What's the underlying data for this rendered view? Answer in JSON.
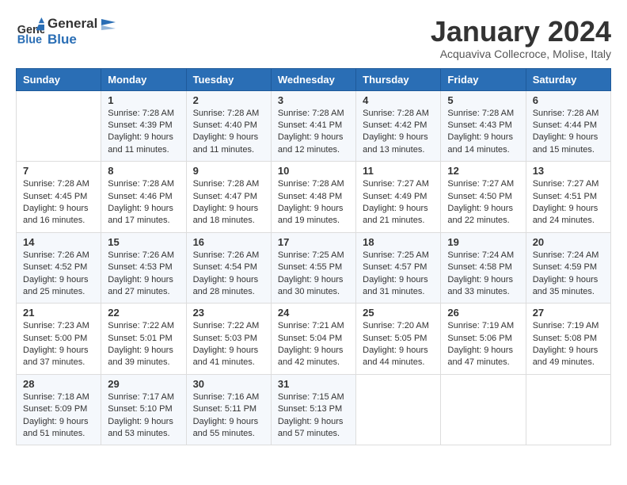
{
  "header": {
    "logo_line1": "General",
    "logo_line2": "Blue",
    "month": "January 2024",
    "location": "Acquaviva Collecroce, Molise, Italy"
  },
  "columns": [
    "Sunday",
    "Monday",
    "Tuesday",
    "Wednesday",
    "Thursday",
    "Friday",
    "Saturday"
  ],
  "weeks": [
    [
      {
        "day": "",
        "sunrise": "",
        "sunset": "",
        "daylight": ""
      },
      {
        "day": "1",
        "sunrise": "Sunrise: 7:28 AM",
        "sunset": "Sunset: 4:39 PM",
        "daylight": "Daylight: 9 hours and 11 minutes."
      },
      {
        "day": "2",
        "sunrise": "Sunrise: 7:28 AM",
        "sunset": "Sunset: 4:40 PM",
        "daylight": "Daylight: 9 hours and 11 minutes."
      },
      {
        "day": "3",
        "sunrise": "Sunrise: 7:28 AM",
        "sunset": "Sunset: 4:41 PM",
        "daylight": "Daylight: 9 hours and 12 minutes."
      },
      {
        "day": "4",
        "sunrise": "Sunrise: 7:28 AM",
        "sunset": "Sunset: 4:42 PM",
        "daylight": "Daylight: 9 hours and 13 minutes."
      },
      {
        "day": "5",
        "sunrise": "Sunrise: 7:28 AM",
        "sunset": "Sunset: 4:43 PM",
        "daylight": "Daylight: 9 hours and 14 minutes."
      },
      {
        "day": "6",
        "sunrise": "Sunrise: 7:28 AM",
        "sunset": "Sunset: 4:44 PM",
        "daylight": "Daylight: 9 hours and 15 minutes."
      }
    ],
    [
      {
        "day": "7",
        "sunrise": "Sunrise: 7:28 AM",
        "sunset": "Sunset: 4:45 PM",
        "daylight": "Daylight: 9 hours and 16 minutes."
      },
      {
        "day": "8",
        "sunrise": "Sunrise: 7:28 AM",
        "sunset": "Sunset: 4:46 PM",
        "daylight": "Daylight: 9 hours and 17 minutes."
      },
      {
        "day": "9",
        "sunrise": "Sunrise: 7:28 AM",
        "sunset": "Sunset: 4:47 PM",
        "daylight": "Daylight: 9 hours and 18 minutes."
      },
      {
        "day": "10",
        "sunrise": "Sunrise: 7:28 AM",
        "sunset": "Sunset: 4:48 PM",
        "daylight": "Daylight: 9 hours and 19 minutes."
      },
      {
        "day": "11",
        "sunrise": "Sunrise: 7:27 AM",
        "sunset": "Sunset: 4:49 PM",
        "daylight": "Daylight: 9 hours and 21 minutes."
      },
      {
        "day": "12",
        "sunrise": "Sunrise: 7:27 AM",
        "sunset": "Sunset: 4:50 PM",
        "daylight": "Daylight: 9 hours and 22 minutes."
      },
      {
        "day": "13",
        "sunrise": "Sunrise: 7:27 AM",
        "sunset": "Sunset: 4:51 PM",
        "daylight": "Daylight: 9 hours and 24 minutes."
      }
    ],
    [
      {
        "day": "14",
        "sunrise": "Sunrise: 7:26 AM",
        "sunset": "Sunset: 4:52 PM",
        "daylight": "Daylight: 9 hours and 25 minutes."
      },
      {
        "day": "15",
        "sunrise": "Sunrise: 7:26 AM",
        "sunset": "Sunset: 4:53 PM",
        "daylight": "Daylight: 9 hours and 27 minutes."
      },
      {
        "day": "16",
        "sunrise": "Sunrise: 7:26 AM",
        "sunset": "Sunset: 4:54 PM",
        "daylight": "Daylight: 9 hours and 28 minutes."
      },
      {
        "day": "17",
        "sunrise": "Sunrise: 7:25 AM",
        "sunset": "Sunset: 4:55 PM",
        "daylight": "Daylight: 9 hours and 30 minutes."
      },
      {
        "day": "18",
        "sunrise": "Sunrise: 7:25 AM",
        "sunset": "Sunset: 4:57 PM",
        "daylight": "Daylight: 9 hours and 31 minutes."
      },
      {
        "day": "19",
        "sunrise": "Sunrise: 7:24 AM",
        "sunset": "Sunset: 4:58 PM",
        "daylight": "Daylight: 9 hours and 33 minutes."
      },
      {
        "day": "20",
        "sunrise": "Sunrise: 7:24 AM",
        "sunset": "Sunset: 4:59 PM",
        "daylight": "Daylight: 9 hours and 35 minutes."
      }
    ],
    [
      {
        "day": "21",
        "sunrise": "Sunrise: 7:23 AM",
        "sunset": "Sunset: 5:00 PM",
        "daylight": "Daylight: 9 hours and 37 minutes."
      },
      {
        "day": "22",
        "sunrise": "Sunrise: 7:22 AM",
        "sunset": "Sunset: 5:01 PM",
        "daylight": "Daylight: 9 hours and 39 minutes."
      },
      {
        "day": "23",
        "sunrise": "Sunrise: 7:22 AM",
        "sunset": "Sunset: 5:03 PM",
        "daylight": "Daylight: 9 hours and 41 minutes."
      },
      {
        "day": "24",
        "sunrise": "Sunrise: 7:21 AM",
        "sunset": "Sunset: 5:04 PM",
        "daylight": "Daylight: 9 hours and 42 minutes."
      },
      {
        "day": "25",
        "sunrise": "Sunrise: 7:20 AM",
        "sunset": "Sunset: 5:05 PM",
        "daylight": "Daylight: 9 hours and 44 minutes."
      },
      {
        "day": "26",
        "sunrise": "Sunrise: 7:19 AM",
        "sunset": "Sunset: 5:06 PM",
        "daylight": "Daylight: 9 hours and 47 minutes."
      },
      {
        "day": "27",
        "sunrise": "Sunrise: 7:19 AM",
        "sunset": "Sunset: 5:08 PM",
        "daylight": "Daylight: 9 hours and 49 minutes."
      }
    ],
    [
      {
        "day": "28",
        "sunrise": "Sunrise: 7:18 AM",
        "sunset": "Sunset: 5:09 PM",
        "daylight": "Daylight: 9 hours and 51 minutes."
      },
      {
        "day": "29",
        "sunrise": "Sunrise: 7:17 AM",
        "sunset": "Sunset: 5:10 PM",
        "daylight": "Daylight: 9 hours and 53 minutes."
      },
      {
        "day": "30",
        "sunrise": "Sunrise: 7:16 AM",
        "sunset": "Sunset: 5:11 PM",
        "daylight": "Daylight: 9 hours and 55 minutes."
      },
      {
        "day": "31",
        "sunrise": "Sunrise: 7:15 AM",
        "sunset": "Sunset: 5:13 PM",
        "daylight": "Daylight: 9 hours and 57 minutes."
      },
      {
        "day": "",
        "sunrise": "",
        "sunset": "",
        "daylight": ""
      },
      {
        "day": "",
        "sunrise": "",
        "sunset": "",
        "daylight": ""
      },
      {
        "day": "",
        "sunrise": "",
        "sunset": "",
        "daylight": ""
      }
    ]
  ]
}
